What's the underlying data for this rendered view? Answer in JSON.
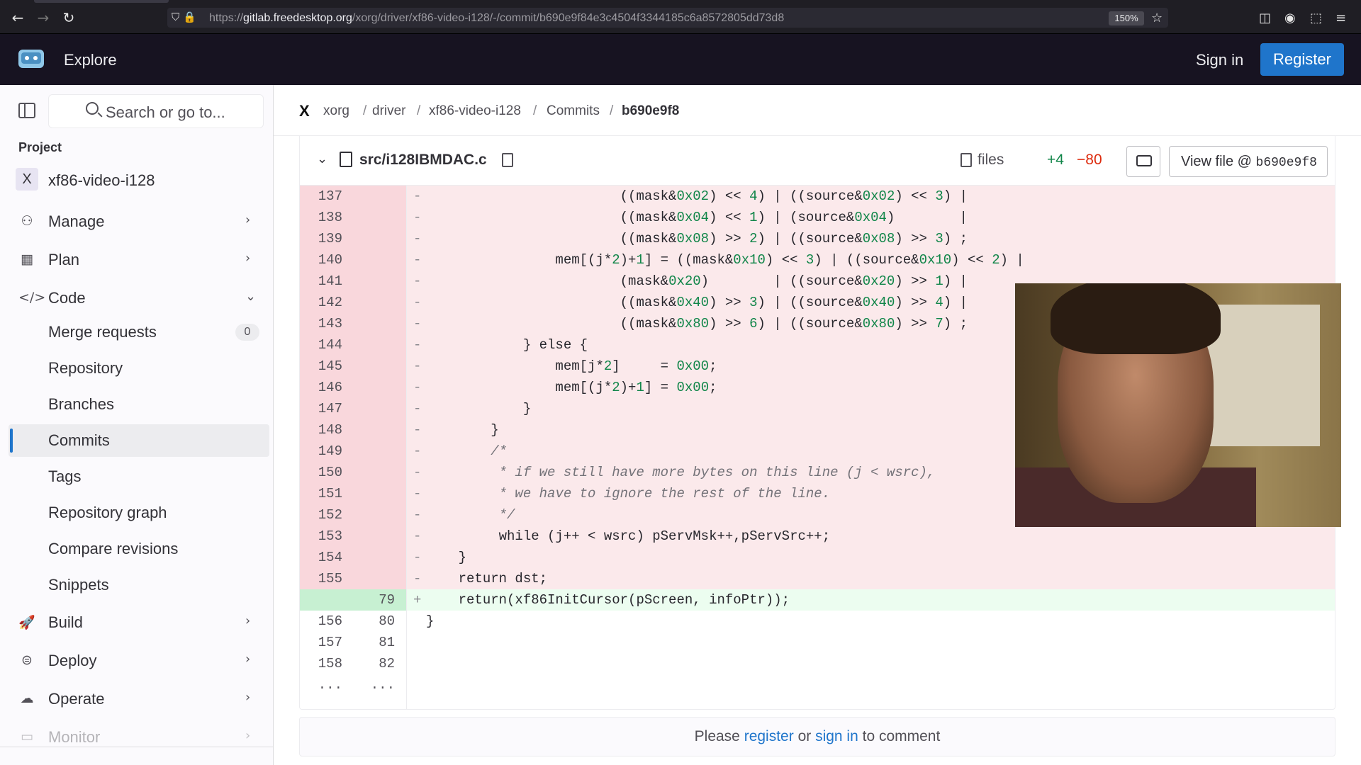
{
  "browser": {
    "url_prefix": "https://",
    "url_host": "gitlab.freedesktop.org",
    "url_path": "/xorg/driver/xf86-video-i128/-/commit/b690e9f84e3c4504f3344185c6a8572805dd73d8",
    "zoom": "150%"
  },
  "header": {
    "explore": "Explore",
    "sign_in": "Sign in",
    "register": "Register"
  },
  "sidebar": {
    "search_placeholder": "Search or go to...",
    "section_label": "Project",
    "project_avatar": "X",
    "project_name": "xf86-video-i128",
    "items": {
      "manage": "Manage",
      "plan": "Plan",
      "code": "Code",
      "build": "Build",
      "deploy": "Deploy",
      "operate": "Operate",
      "monitor": "Monitor"
    },
    "code_sub": {
      "merge_requests": "Merge requests",
      "merge_requests_count": "0",
      "repository": "Repository",
      "branches": "Branches",
      "commits": "Commits",
      "tags": "Tags",
      "repository_graph": "Repository graph",
      "compare_revisions": "Compare revisions",
      "snippets": "Snippets"
    }
  },
  "breadcrumb": {
    "logo": "X",
    "items": [
      "xorg",
      "driver",
      "xf86-video-i128",
      "Commits",
      "b690e9f8"
    ]
  },
  "file": {
    "name": "src/i128IBMDAC.c",
    "files_label": "files",
    "additions": "+4",
    "deletions": "−80",
    "view_file_label": "View file @ ",
    "view_file_sha": "b690e9f8"
  },
  "comment": {
    "prefix": "Please ",
    "register": "register",
    "middle": " or ",
    "sign_in": "sign in",
    "suffix": " to comment"
  }
}
